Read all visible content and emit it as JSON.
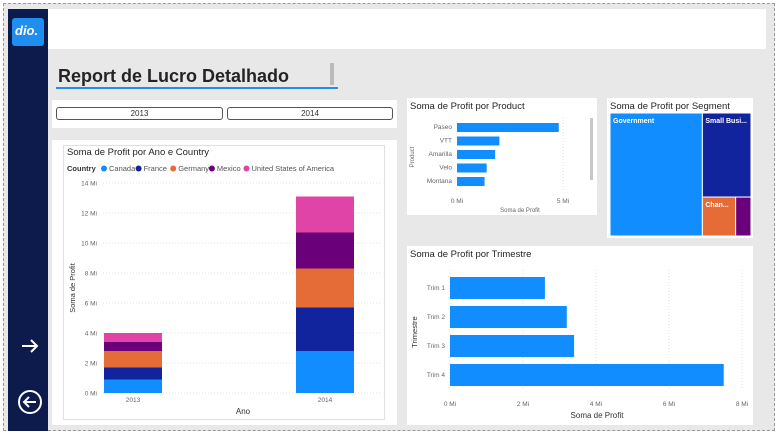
{
  "app": {
    "logo_text": "dio."
  },
  "report": {
    "title": "Report de Lucro Detalhado"
  },
  "slicer": {
    "years": [
      "2013",
      "2014"
    ]
  },
  "nav": {
    "next_icon": "arrow-right-icon",
    "back_icon": "arrow-left-circle-icon"
  },
  "colors": {
    "canada": "#118dff",
    "france": "#12239e",
    "germany": "#e66c37",
    "mexico": "#6b007b",
    "usa": "#e044a7",
    "bar": "#118dff",
    "nav": "#0d1b4c"
  },
  "chart_ano_country": {
    "title": "Soma de Profit por Ano e Country",
    "legend_title": "Country",
    "chart_data": {
      "type": "bar",
      "stacked": true,
      "categories": [
        "2013",
        "2014"
      ],
      "xlabel": "Ano",
      "ylabel": "Soma de Profit",
      "ylim": [
        0,
        14
      ],
      "y_ticks": [
        "0 Mi",
        "2 Mi",
        "4 Mi",
        "6 Mi",
        "8 Mi",
        "10 Mi",
        "12 Mi",
        "14 Mi"
      ],
      "series": [
        {
          "name": "Canada",
          "values": [
            0.9,
            2.8
          ]
        },
        {
          "name": "France",
          "values": [
            0.8,
            2.9
          ]
        },
        {
          "name": "Germany",
          "values": [
            1.1,
            2.6
          ]
        },
        {
          "name": "Mexico",
          "values": [
            0.6,
            2.4
          ]
        },
        {
          "name": "United States of America",
          "values": [
            0.6,
            2.4
          ]
        }
      ]
    }
  },
  "chart_product": {
    "title": "Soma de Profit por Product",
    "chart_data": {
      "type": "bar",
      "orientation": "horizontal",
      "categories": [
        "Paseo",
        "VTT",
        "Amarilla",
        "Velo",
        "Montana"
      ],
      "values": [
        4.8,
        2.0,
        1.8,
        1.4,
        1.3
      ],
      "xlabel": "Soma de Profit",
      "ylabel": "Product",
      "x_ticks": [
        "0 Mi",
        "5 Mi"
      ],
      "xlim": [
        0,
        6
      ]
    }
  },
  "chart_segment": {
    "title": "Soma de Profit por Segment",
    "chart_data": {
      "type": "treemap",
      "labels": [
        "Government",
        "Small Busi...",
        "Chan...",
        ""
      ],
      "values": [
        11.4,
        4.1,
        1.3,
        0.6
      ]
    }
  },
  "chart_trimestre": {
    "title": "Soma de Profit por Trimestre",
    "chart_data": {
      "type": "bar",
      "orientation": "horizontal",
      "categories": [
        "Trim 1",
        "Trim 2",
        "Trim 3",
        "Trim 4"
      ],
      "values": [
        2.6,
        3.2,
        3.4,
        7.5
      ],
      "xlabel": "Soma de Profit",
      "ylabel": "Trimestre",
      "x_ticks": [
        "0 Mi",
        "2 Mi",
        "4 Mi",
        "6 Mi",
        "8 Mi"
      ],
      "xlim": [
        0,
        8
      ]
    }
  }
}
